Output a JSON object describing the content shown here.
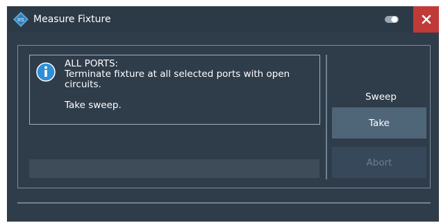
{
  "window": {
    "title": "Measure Fixture",
    "logo_icon": "rohde-schwarz-logo",
    "toggle_icon": "toggle-icon",
    "close_icon": "close-icon"
  },
  "message": {
    "icon": "info-icon",
    "heading": "ALL PORTS:",
    "line1": "Terminate fixture at all selected ports with open",
    "line2": "circuits.",
    "line3": "Take sweep."
  },
  "progress": {
    "value": 0
  },
  "sweep": {
    "label": "Sweep",
    "take_label": "Take",
    "abort_label": "Abort",
    "abort_enabled": false
  },
  "colors": {
    "background": "#2f3c4a",
    "close": "#c13a3a",
    "take_button": "#4f6578",
    "abort_button": "#37485a"
  }
}
